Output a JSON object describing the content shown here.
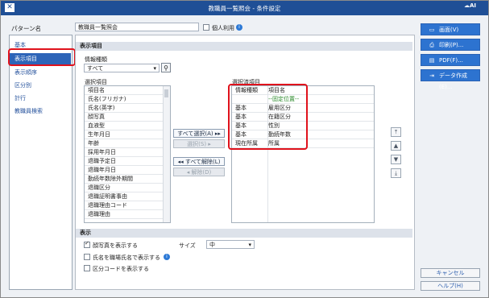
{
  "window": {
    "title": "教職員一覧照会 - 条件設定",
    "logo_text": "AI"
  },
  "pattern": {
    "label": "パターン名",
    "value": "教職員一覧照会",
    "personal_use_label": "個人利用"
  },
  "sidebar": {
    "items": [
      {
        "label": "基本"
      },
      {
        "label": "表示項目"
      },
      {
        "label": "表示順序"
      },
      {
        "label": "区分別"
      },
      {
        "label": "計行"
      },
      {
        "label": "教職員検索"
      }
    ]
  },
  "display_items": {
    "section_title": "表示項目",
    "info_type_label": "情報種類",
    "info_type_value": "すべて",
    "selection_label": "選択項目",
    "selection_header": "項目名",
    "selection_items": [
      "氏名(フリガナ)",
      "氏名(英字)",
      "顔写真",
      "血液型",
      "生年月日",
      "年齢",
      "採用年月日",
      "退職予定日",
      "退職年月日",
      "勤続年数除外期間",
      "退職区分",
      "退職証明書事由",
      "退職理由コード",
      "退職理由"
    ],
    "selected_label": "選択済項目",
    "selected_headers": [
      "情報種類",
      "項目名"
    ],
    "selected_items": [
      {
        "type": "",
        "name": "--固定位置--"
      },
      {
        "type": "基本",
        "name": "雇用区分"
      },
      {
        "type": "基本",
        "name": "在籍区分"
      },
      {
        "type": "基本",
        "name": "性別"
      },
      {
        "type": "基本",
        "name": "勤続年数"
      },
      {
        "type": "現在所属",
        "name": "所属"
      }
    ],
    "buttons": {
      "select_all": "すべて選択(A)",
      "select": "選択(S)",
      "remove_all": "すべて解除(L)",
      "remove": "解除(D)"
    }
  },
  "display": {
    "section_title": "表示",
    "show_photo_label": "顔写真を表示する",
    "size_label": "サイズ",
    "size_value": "中",
    "show_job_title_label": "氏名を職場氏名で表示する",
    "show_category_code_label": "区分コードを表示する"
  },
  "actions": {
    "screen": "画面(V)",
    "print": "印刷(P)...",
    "pdf": "PDF(F)...",
    "data": "データ作成(E)...",
    "cancel": "キャンセル",
    "help": "ヘルプ(H)"
  },
  "colors": {
    "title_bar": "#1f4f96",
    "accent": "#2d73d0",
    "highlight": "#e0121c"
  }
}
